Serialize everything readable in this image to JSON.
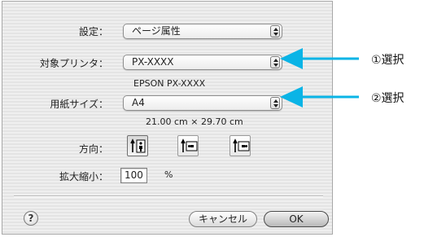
{
  "dialog": {
    "settings": {
      "label": "設定：",
      "value": "ページ属性"
    },
    "printer": {
      "label": "対象プリンタ：",
      "value": "PX-XXXX",
      "subtext": "EPSON PX-XXXX"
    },
    "paper": {
      "label": "用紙サイズ：",
      "value": "A4",
      "subtext": "21.00 cm × 29.70 cm"
    },
    "orientation": {
      "label": "方向："
    },
    "scale": {
      "label": "拡大縮小：",
      "value": "100",
      "unit": "%"
    },
    "help_glyph": "?",
    "cancel_label": "キャンセル",
    "ok_label": "OK"
  },
  "annotations": [
    {
      "text": "①選択"
    },
    {
      "text": "②選択"
    }
  ],
  "colors": {
    "arrow": "#0ab4e6"
  }
}
